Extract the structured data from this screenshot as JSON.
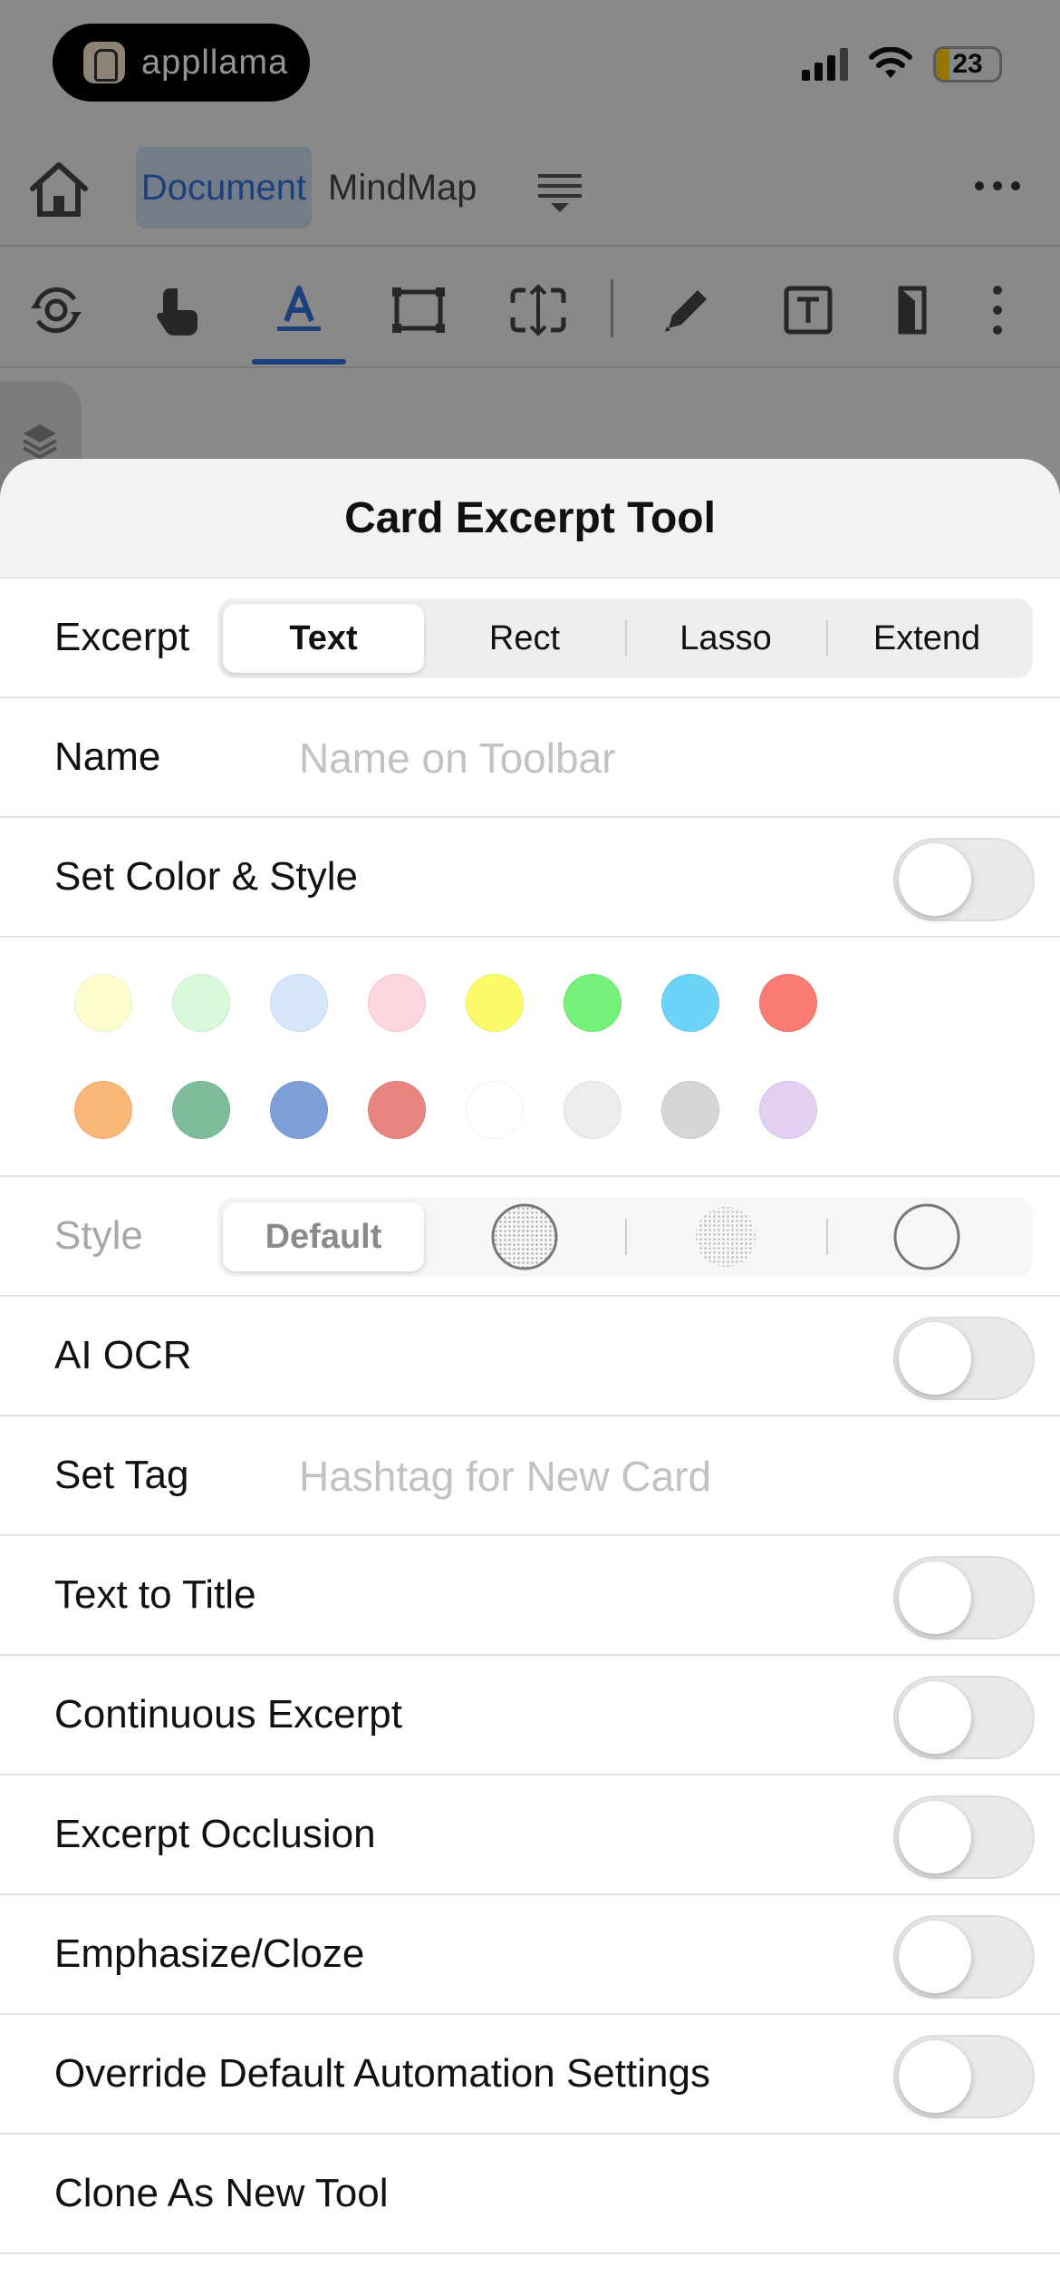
{
  "status": {
    "app_name": "appllama",
    "battery": "23"
  },
  "nav": {
    "tabs": [
      {
        "label": "Document",
        "active": true
      },
      {
        "label": "MindMap",
        "active": false
      }
    ]
  },
  "toolbar": {
    "icons": [
      "gear-refresh-icon",
      "hand-pointer-icon",
      "text-highlight-icon",
      "rectangle-select-icon",
      "expand-vertical-icon",
      "pencil-icon",
      "text-box-icon",
      "card-icon",
      "more-vertical-icon"
    ],
    "active": "text-highlight-icon"
  },
  "sheet": {
    "title": "Card Excerpt Tool",
    "excerpt": {
      "label": "Excerpt",
      "options": [
        "Text",
        "Rect",
        "Lasso",
        "Extend"
      ],
      "selected": "Text"
    },
    "name": {
      "label": "Name",
      "placeholder": "Name on Toolbar",
      "value": ""
    },
    "set_color_style": {
      "label": "Set Color & Style",
      "on": false
    },
    "colors": [
      "#fdfdd0",
      "#d8fadb",
      "#d6e6fb",
      "#fdd6de",
      "#fbfb6a",
      "#74f07b",
      "#6dd4f8",
      "#fa7a74",
      "#fbb777",
      "#7dbd9c",
      "#7f9fd8",
      "#e6867f",
      "#ffffff",
      "#ededed",
      "#d6d6d6",
      "#e2cff1"
    ],
    "style": {
      "label": "Style",
      "options": [
        "Default",
        "dotted-fill-outline",
        "dotted-fill",
        "outline"
      ],
      "selected": "Default"
    },
    "ai_ocr": {
      "label": "AI OCR",
      "on": false
    },
    "set_tag": {
      "label": "Set Tag",
      "placeholder": "Hashtag for New Card",
      "value": ""
    },
    "toggles": [
      {
        "label": "Text to Title",
        "on": false
      },
      {
        "label": "Continuous Excerpt",
        "on": false
      },
      {
        "label": "Excerpt Occlusion",
        "on": false
      },
      {
        "label": "Emphasize/Cloze",
        "on": false
      },
      {
        "label": "Override Default Automation Settings",
        "on": false
      }
    ],
    "clone": {
      "label": "Clone As New Tool"
    }
  }
}
